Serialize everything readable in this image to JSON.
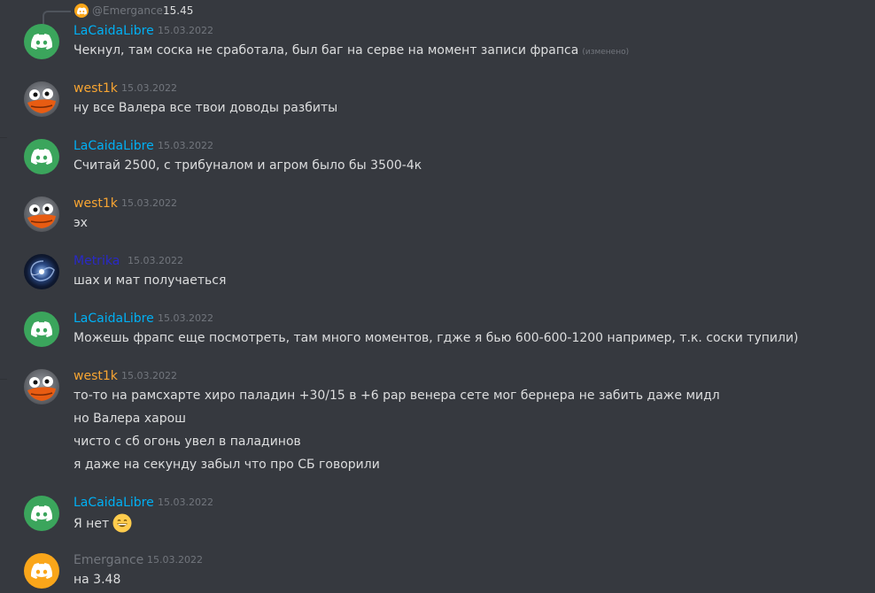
{
  "reply": {
    "author": "@Emergance",
    "text": "15.45"
  },
  "messages": [
    {
      "author": "LaCaidaLibre",
      "author_color": "#00b0f4",
      "avatar": "discord-logo-icon",
      "time": "15.03.2022",
      "lines": [
        "Чекнул, там соска не сработала, был баг на серве на момент записи фрапса"
      ],
      "edited": "(изменено)"
    },
    {
      "author": "west1k",
      "author_color": "#f8a532",
      "avatar": "duck-avatar",
      "time": "15.03.2022",
      "lines": [
        "ну все Валера все твои доводы разбиты"
      ]
    },
    {
      "author": "LaCaidaLibre",
      "author_color": "#00b0f4",
      "avatar": "discord-logo-icon",
      "time": "15.03.2022",
      "lines": [
        "Считай 2500, с трибуналом и агром было бы 3500-4к"
      ]
    },
    {
      "author": "west1k",
      "author_color": "#f8a532",
      "avatar": "duck-avatar",
      "time": "15.03.2022",
      "lines": [
        "эх"
      ]
    },
    {
      "author": "Metrika",
      "author_color": "#2929c9",
      "avatar": "galaxy-avatar",
      "time": "15.03.2022",
      "lines": [
        "шах  и мат получаеться"
      ]
    },
    {
      "author": "LaCaidaLibre",
      "author_color": "#00b0f4",
      "avatar": "discord-logo-icon",
      "time": "15.03.2022",
      "lines": [
        "Можешь фрапс еще посмотреть, там много моментов, гдже я бью 600-600-1200 например, т.к. соски тупили)"
      ]
    },
    {
      "author": "west1k",
      "author_color": "#f8a532",
      "avatar": "duck-avatar",
      "time": "15.03.2022",
      "lines": [
        "то-то на рамсхарте хиро паладин +30/15 в +6 рар венера сете мог бернера не забить даже мидл",
        "но Валера харош",
        "чисто с сб огонь увел в паладинов",
        "я даже на секунду забыл что про СБ говорили"
      ]
    },
    {
      "author": "LaCaidaLibre",
      "author_color": "#00b0f4",
      "avatar": "discord-logo-icon",
      "time": "15.03.2022",
      "lines": [
        "Я нет"
      ],
      "emoji": "grinning-face-emoji"
    },
    {
      "author": "Emergance",
      "author_color": "#72767d",
      "avatar": "discord-logo-icon",
      "time": "15.03.2022",
      "lines": [
        "на 3.48"
      ]
    }
  ]
}
